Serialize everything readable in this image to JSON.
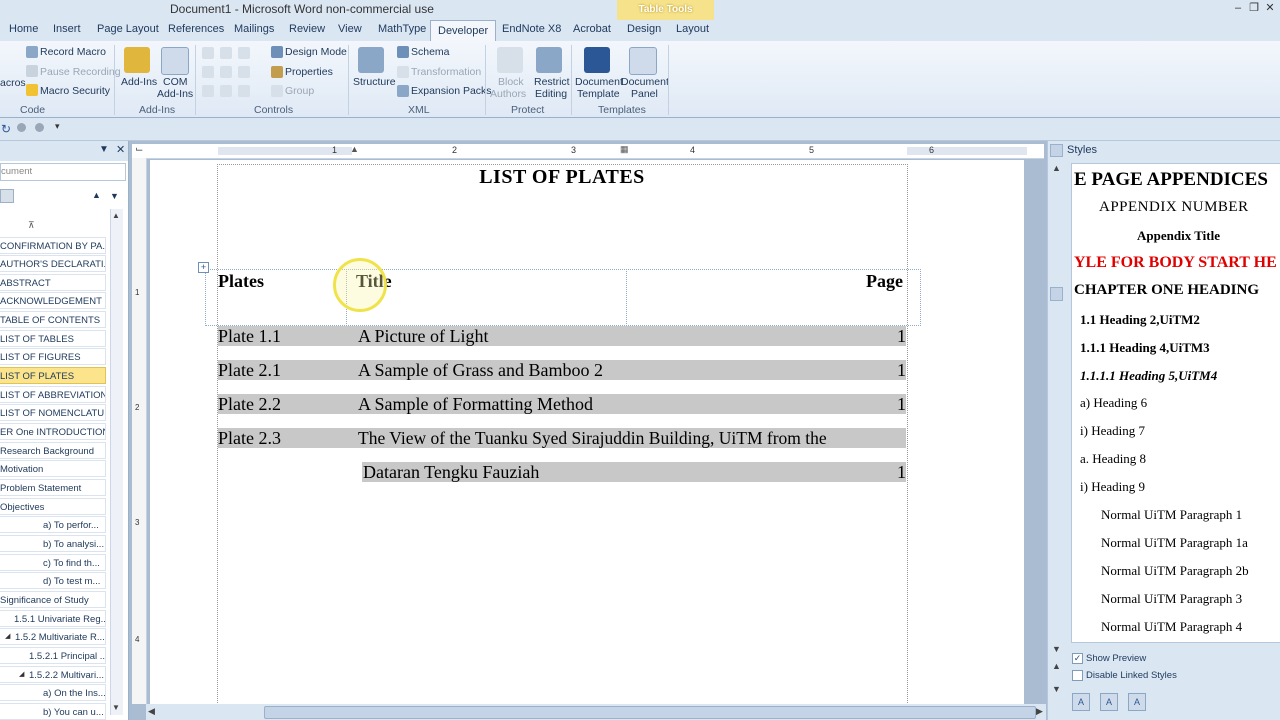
{
  "window": {
    "title": "Document1 - Microsoft Word non-commercial use",
    "context_tab": "Table Tools"
  },
  "tabs": [
    "Home",
    "Insert",
    "Page Layout",
    "References",
    "Mailings",
    "Review",
    "View",
    "MathType",
    "Developer",
    "EndNote X8",
    "Acrobat",
    "Design",
    "Layout"
  ],
  "active_tab": "Developer",
  "ribbon": {
    "code": {
      "label": "Code",
      "macros": "acros",
      "record_macro": "Record Macro",
      "pause_recording": "Pause Recording",
      "macro_security": "Macro Security"
    },
    "addins": {
      "label": "Add-Ins",
      "addins": "Add-Ins",
      "com_addins_1": "COM",
      "com_addins_2": "Add-Ins"
    },
    "controls": {
      "label": "Controls",
      "design_mode": "Design Mode",
      "properties": "Properties",
      "group": "Group"
    },
    "xml": {
      "label": "XML",
      "structure": "Structure",
      "schema": "Schema",
      "transformation": "Transformation",
      "expansion_packs": "Expansion Packs"
    },
    "protect": {
      "label": "Protect",
      "block_authors_1": "Block",
      "block_authors_2": "Authors",
      "restrict_editing_1": "Restrict",
      "restrict_editing_2": "Editing"
    },
    "templates": {
      "label": "Templates",
      "document_template_1": "Document",
      "document_template_2": "Template",
      "document_panel_1": "Document",
      "document_panel_2": "Panel"
    }
  },
  "nav_pane": {
    "search_placeholder": "cument",
    "items": [
      "CONFIRMATION BY PA...",
      "AUTHOR'S DECLARATI...",
      "ABSTRACT",
      "ACKNOWLEDGEMENT",
      "TABLE OF CONTENTS",
      "LIST OF TABLES",
      "LIST OF FIGURES",
      "LIST OF PLATES",
      "LIST OF ABBREVIATIONS",
      "LIST OF NOMENCLATU...",
      "ER One  INTRODUCTION",
      "Research Background",
      "Motivation",
      "Problem Statement",
      "Objectives",
      "a) To perfor...",
      "b) To analysi...",
      "c) To find th...",
      "d) To test m...",
      "Significance of Study",
      "1.5.1 Univariate Reg...",
      "1.5.2 Multivariate R...",
      "1.5.2.1 Principal ...",
      "1.5.2.2 Multivari...",
      "a) On the Ins...",
      "b) You can u..."
    ],
    "selected": "LIST OF PLATES"
  },
  "ruler": {
    "numbers": [
      "1",
      "2",
      "3",
      "4",
      "5",
      "6"
    ]
  },
  "vruler": {
    "numbers": [
      "1",
      "2",
      "3",
      "4"
    ]
  },
  "document": {
    "heading": "LIST OF PLATES",
    "header_row": {
      "plates": "Plates",
      "title": "Title",
      "page": "Page"
    },
    "rows": [
      {
        "plate": "Plate 1.1",
        "title": "A Picture of Light",
        "page": "1"
      },
      {
        "plate": "Plate 2.1",
        "title": "A Sample of Grass and Bamboo 2",
        "page": "1"
      },
      {
        "plate": "Plate 2.2",
        "title": "A Sample of Formatting Method",
        "page": "1"
      },
      {
        "plate": "Plate 2.3",
        "title": "The View of the Tuanku Syed Sirajuddin Building, UiTM from the",
        "page": ""
      },
      {
        "plate": "",
        "title": "Dataran Tengku Fauziah",
        "page": "1"
      }
    ]
  },
  "styles_pane": {
    "title": "Styles",
    "styles": [
      "E PAGE APPENDICES",
      "APPENDIX NUMBER",
      "Appendix Title",
      "YLE FOR BODY START HE",
      "CHAPTER ONE  HEADING",
      "1.1  Heading 2,UiTM2",
      "1.1.1  Heading 4,UiTM3",
      "1.1.1.1  Heading 5,UiTM4",
      "a)  Heading 6",
      "i)  Heading 7",
      "a.  Heading 8",
      "i)  Heading 9",
      "Normal UiTM Paragraph 1",
      "Normal UiTM Paragraph 1a",
      "Normal UiTM Paragraph 2b",
      "Normal UiTM Paragraph 3",
      "Normal UiTM Paragraph 4"
    ],
    "show_preview": "Show Preview",
    "show_preview_checked": true,
    "disable_linked": "Disable Linked Styles",
    "disable_linked_checked": false
  },
  "colors": {
    "red_style": "#e00000",
    "selected_nav": "#fbe48b",
    "table_tools": "#f5e28a",
    "row_shading": "#c8c8c8"
  }
}
